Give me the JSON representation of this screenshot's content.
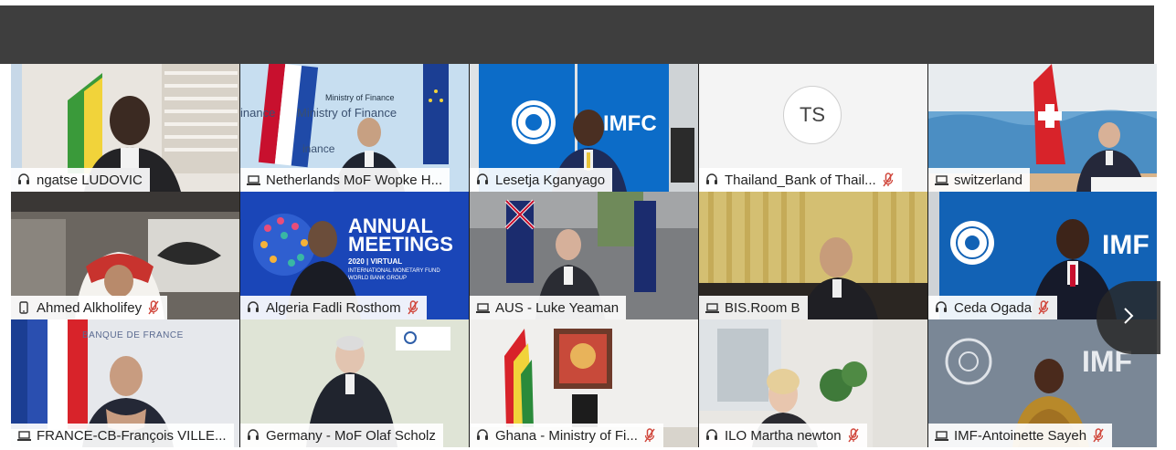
{
  "participants": [
    {
      "name": "ngatse LUDOVIC",
      "device": "headset",
      "muted": false,
      "active": true
    },
    {
      "name": "Netherlands MoF Wopke H...",
      "device": "laptop",
      "muted": false,
      "active": false,
      "background_text": [
        "Ministry of Finance",
        "inance",
        "Ministry of Finance",
        "inance"
      ]
    },
    {
      "name": "Lesetja Kganyago",
      "device": "headset",
      "muted": false,
      "active": false,
      "background_text": "IMFC"
    },
    {
      "name": "Thailand_Bank of Thail...",
      "device": "headset",
      "muted": true,
      "active": false,
      "initials": "TS"
    },
    {
      "name": "switzerland",
      "device": "laptop",
      "muted": false,
      "active": false
    },
    {
      "name": "Ahmed Alkholifey",
      "device": "phone",
      "muted": true,
      "active": false
    },
    {
      "name": "Algeria Fadli Rosthom",
      "device": "headset",
      "muted": true,
      "active": false,
      "background_text": [
        "ANNUAL",
        "MEETINGS",
        "2020 | VIRTUAL",
        "INTERNATIONAL MONETARY FUND",
        "WORLD BANK GROUP"
      ]
    },
    {
      "name": "AUS - Luke Yeaman",
      "device": "laptop",
      "muted": false,
      "active": false
    },
    {
      "name": "BIS.Room B",
      "device": "laptop",
      "muted": false,
      "active": false
    },
    {
      "name": "Ceda Ogada",
      "device": "headset",
      "muted": true,
      "active": false,
      "background_text": "IMF"
    },
    {
      "name": "FRANCE-CB-François VILLE...",
      "device": "laptop",
      "muted": false,
      "active": false,
      "background_text": "BANQUE DE FRANCE"
    },
    {
      "name": "Germany - MoF Olaf Scholz",
      "device": "headset",
      "muted": false,
      "active": false
    },
    {
      "name": "Ghana - Ministry of Fi...",
      "device": "headset",
      "muted": true,
      "active": false
    },
    {
      "name": "ILO Martha newton",
      "device": "headset",
      "muted": true,
      "active": false
    },
    {
      "name": "IMF-Antoinette Sayeh",
      "device": "laptop",
      "muted": true,
      "active": false,
      "background_text": "IMF"
    }
  ],
  "colors": {
    "active_border": "#5fc5ef",
    "muted_icon": "#d0453a",
    "topbar": "#3e3e3e"
  },
  "icons": {
    "headset": "headset-icon",
    "laptop": "laptop-icon",
    "phone": "phone-icon",
    "muted": "mic-muted-icon",
    "next": "chevron-right-icon"
  }
}
